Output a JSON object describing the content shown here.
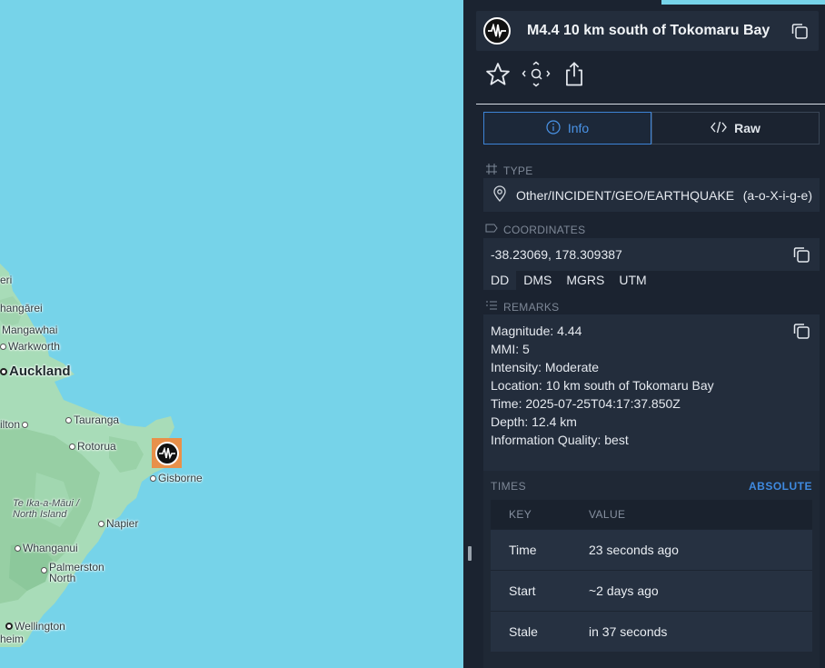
{
  "map": {
    "places": {
      "p1": "eri",
      "whangarei": "hangārei",
      "mangawhai": "Mangawhai",
      "warkworth": "Warkworth",
      "auckland": "Auckland",
      "hamilton": "ilton",
      "tauranga": "Tauranga",
      "rotorua": "Rotorua",
      "gisborne": "Gisborne",
      "region": "Te Ika-a-Māui / North Island",
      "napier": "Napier",
      "whanganui": "Whanganui",
      "palmerston": "Palmerston North",
      "wellington": "Wellington",
      "nelson": "heim"
    },
    "marker_icon": "earthquake-icon"
  },
  "panel": {
    "title": "M4.4 10 km south of Tokomaru Bay",
    "icons": [
      "earthquake-icon",
      "copy-icon",
      "star-icon",
      "zoom-to-icon",
      "share-icon"
    ],
    "tabs": [
      {
        "label": "Info",
        "icon": "info-icon",
        "active": true
      },
      {
        "label": "Raw",
        "icon": "code-icon",
        "active": false
      }
    ],
    "type": {
      "label": "TYPE",
      "value": "Other/INCIDENT/GEO/EARTHQUAKE",
      "code": "(a-o-X-i-g-e)"
    },
    "coordinates": {
      "label": "COORDINATES",
      "value": "-38.23069, 178.309387",
      "formats": [
        "DD",
        "DMS",
        "MGRS",
        "UTM"
      ],
      "active_format": "DD"
    },
    "remarks": {
      "label": "REMARKS",
      "lines": [
        "Magnitude: 4.44",
        "MMI: 5",
        "Intensity: Moderate",
        "Location: 10 km south of Tokomaru Bay",
        "Time: 2025-07-25T04:17:37.850Z",
        "Depth: 12.4 km",
        "Information Quality: best"
      ]
    },
    "times": {
      "label": "TIMES",
      "mode": "ABSOLUTE",
      "headers": [
        "KEY",
        "VALUE"
      ],
      "rows": [
        {
          "key": "Time",
          "value": "23 seconds ago"
        },
        {
          "key": "Start",
          "value": "~2 days ago"
        },
        {
          "key": "Stale",
          "value": "in 37 seconds"
        }
      ]
    },
    "colors": {
      "panel_bg": "#1b2330",
      "card_bg": "#232d3c",
      "accent": "#3d84d6",
      "water": "#76d3e9",
      "land": "#a6dcb7",
      "marker": "#e8904a"
    }
  }
}
